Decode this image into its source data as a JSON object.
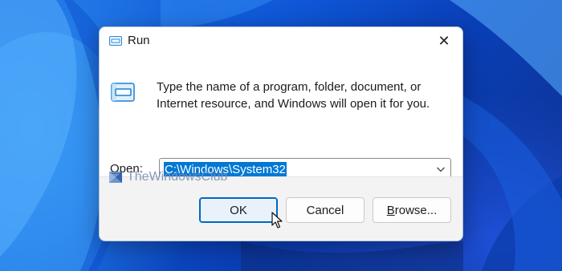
{
  "dialog": {
    "title": "Run",
    "close_glyph": "✕",
    "description": "Type the name of a program, folder, document, or Internet resource, and Windows will open it for you.",
    "open_label_prefix": "O",
    "open_label_rest": "pen:",
    "open_value": "C:\\Windows\\System32",
    "watermark": "TheWindowsClub",
    "buttons": {
      "ok": "OK",
      "cancel": "Cancel",
      "browse_prefix": "B",
      "browse_rest": "rowse..."
    }
  },
  "icons": {
    "title": "run-icon",
    "body": "run-icon",
    "close": "close-icon",
    "dropdown": "chevron-down-icon",
    "cursor": "mouse-pointer-icon",
    "watermark": "thewindowsclub-logo"
  },
  "colors": {
    "accent": "#0067c0",
    "selection": "#0078d4",
    "wallpaper": "#0f58d8"
  }
}
